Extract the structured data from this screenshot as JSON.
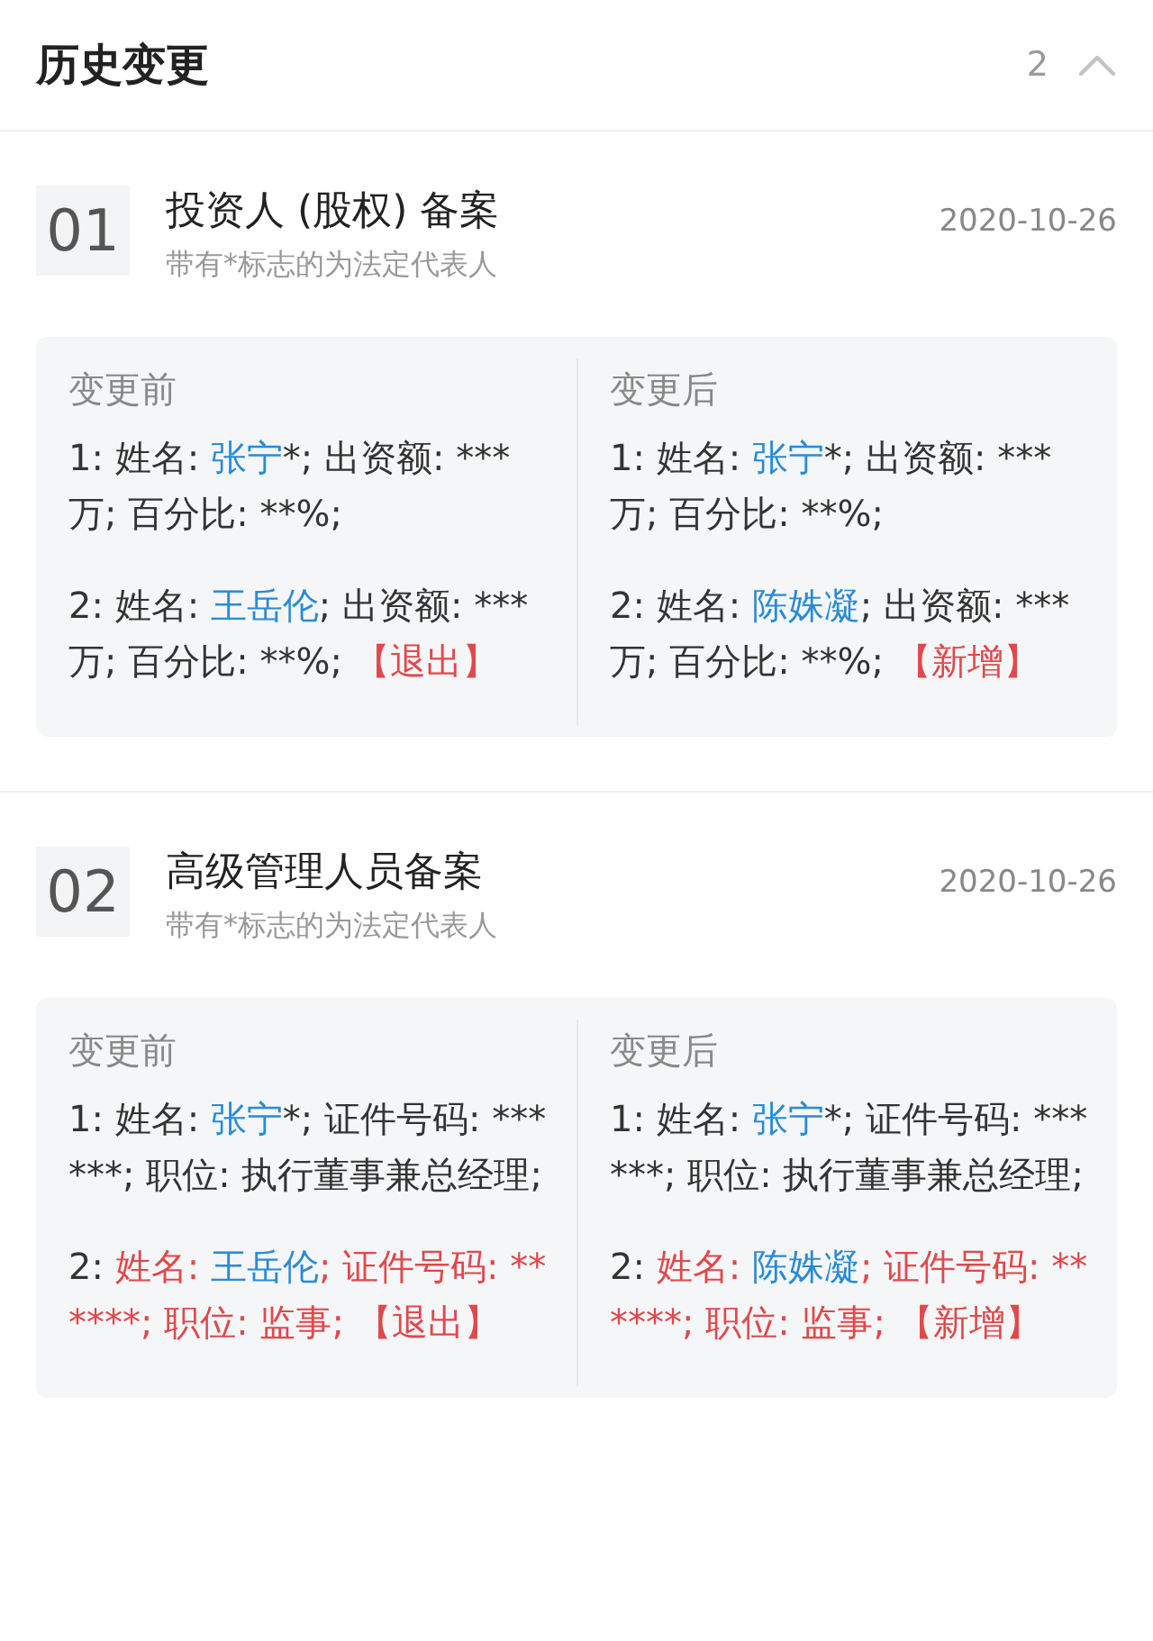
{
  "header": {
    "title": "历史变更",
    "count": "2",
    "expanded": true
  },
  "records": [
    {
      "number": "01",
      "title": "投资人 (股权) 备案",
      "subtitle": "带有*标志的为法定代表人",
      "date": "2020-10-26",
      "columns": [
        {
          "heading": "变更前",
          "entries": [
            [
              {
                "kind": "plain",
                "text": "1: 姓名: "
              },
              {
                "kind": "name",
                "text": "张宁"
              },
              {
                "kind": "plain",
                "text": "*; 出资额: ***万; 百分比: **%;"
              }
            ],
            [
              {
                "kind": "plain",
                "text": "2: 姓名: "
              },
              {
                "kind": "name",
                "text": "王岳伦"
              },
              {
                "kind": "plain",
                "text": "; 出资额: ***万; 百分比: **%; "
              },
              {
                "kind": "flag",
                "text": "【退出】"
              }
            ]
          ]
        },
        {
          "heading": "变更后",
          "entries": [
            [
              {
                "kind": "plain",
                "text": "1: 姓名: "
              },
              {
                "kind": "name",
                "text": "张宁"
              },
              {
                "kind": "plain",
                "text": "*; 出资额: ***万; 百分比: **%;"
              }
            ],
            [
              {
                "kind": "plain",
                "text": "2: 姓名: "
              },
              {
                "kind": "name",
                "text": "陈姝凝"
              },
              {
                "kind": "plain",
                "text": "; 出资额: ***万; 百分比: **%; "
              },
              {
                "kind": "flag",
                "text": "【新增】"
              }
            ]
          ]
        }
      ]
    },
    {
      "number": "02",
      "title": "高级管理人员备案",
      "subtitle": "带有*标志的为法定代表人",
      "date": "2020-10-26",
      "columns": [
        {
          "heading": "变更前",
          "entries": [
            [
              {
                "kind": "plain",
                "text": "1: 姓名: "
              },
              {
                "kind": "name",
                "text": "张宁"
              },
              {
                "kind": "plain",
                "text": "*; 证件号码: ******; 职位: 执行董事兼总经理;"
              }
            ],
            [
              {
                "kind": "plain",
                "text": "2: "
              },
              {
                "kind": "flag",
                "text": "姓名: "
              },
              {
                "kind": "name",
                "text": "王岳伦"
              },
              {
                "kind": "flag",
                "text": "; 证件号码: ******; 职位: 监事; 【退出】"
              }
            ]
          ]
        },
        {
          "heading": "变更后",
          "entries": [
            [
              {
                "kind": "plain",
                "text": "1: 姓名: "
              },
              {
                "kind": "name",
                "text": "张宁"
              },
              {
                "kind": "plain",
                "text": "*; 证件号码: ******; 职位: 执行董事兼总经理;"
              }
            ],
            [
              {
                "kind": "plain",
                "text": "2: "
              },
              {
                "kind": "flag",
                "text": "姓名: "
              },
              {
                "kind": "name",
                "text": "陈姝凝"
              },
              {
                "kind": "flag",
                "text": "; 证件号码: ******; 职位: 监事; 【新增】"
              }
            ]
          ]
        }
      ]
    }
  ]
}
